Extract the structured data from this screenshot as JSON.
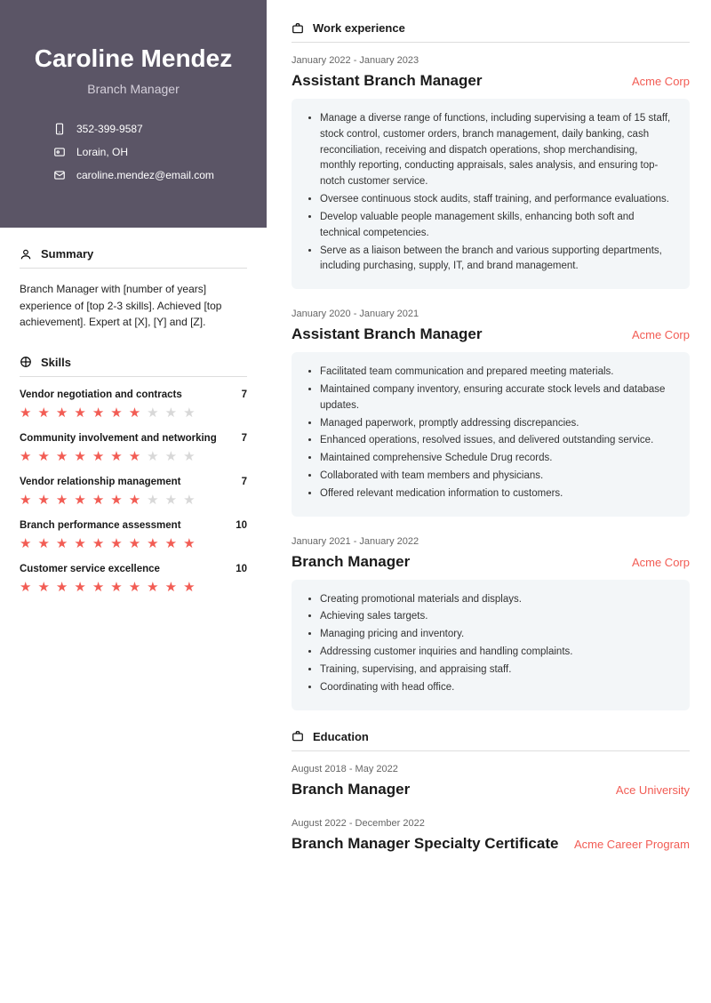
{
  "person": {
    "name": "Caroline Mendez",
    "title": "Branch Manager",
    "phone": "352-399-9587",
    "location": "Lorain, OH",
    "email": "caroline.mendez@email.com"
  },
  "sections": {
    "summary": "Summary",
    "skills": "Skills",
    "work": "Work experience",
    "education": "Education"
  },
  "summary_text": "Branch Manager with [number of years] experience of [top 2-3 skills]. Achieved [top achievement]. Expert at [X], [Y] and [Z].",
  "skills": [
    {
      "name": "Vendor negotiation and contracts",
      "rating": 7
    },
    {
      "name": "Community involvement and networking",
      "rating": 7
    },
    {
      "name": "Vendor relationship management",
      "rating": 7
    },
    {
      "name": "Branch performance assessment",
      "rating": 10
    },
    {
      "name": "Customer service excellence",
      "rating": 10
    }
  ],
  "jobs": [
    {
      "dates": "January 2022 - January 2023",
      "title": "Assistant Branch Manager",
      "company": "Acme Corp",
      "bullets": [
        "Manage a diverse range of functions, including supervising a team of 15 staff, stock control, customer orders, branch management, daily banking, cash reconciliation, receiving and dispatch operations, shop merchandising, monthly reporting, conducting appraisals, sales analysis, and ensuring top-notch customer service.",
        "Oversee continuous stock audits, staff training, and performance evaluations.",
        "Develop valuable people management skills, enhancing both soft and technical competencies.",
        "Serve as a liaison between the branch and various supporting departments, including purchasing, supply, IT, and brand management."
      ]
    },
    {
      "dates": "January 2020 - January 2021",
      "title": "Assistant Branch Manager",
      "company": "Acme Corp",
      "bullets": [
        "Facilitated team communication and prepared meeting materials.",
        "Maintained company inventory, ensuring accurate stock levels and database updates.",
        "Managed paperwork, promptly addressing discrepancies.",
        "Enhanced operations, resolved issues, and delivered outstanding service.",
        "Maintained comprehensive Schedule Drug records.",
        "Collaborated with team members and physicians.",
        "Offered relevant medication information to customers."
      ]
    },
    {
      "dates": "January 2021 - January 2022",
      "title": "Branch Manager",
      "company": "Acme Corp",
      "bullets": [
        "Creating promotional materials and displays.",
        "Achieving sales targets.",
        "Managing pricing and inventory.",
        "Addressing customer inquiries and handling complaints.",
        "Training, supervising, and appraising staff.",
        "Coordinating with head office."
      ]
    }
  ],
  "education": [
    {
      "dates": "August 2018 - May 2022",
      "title": "Branch Manager",
      "school": "Ace University"
    },
    {
      "dates": "August 2022 - December 2022",
      "title": "Branch Manager Specialty Certificate",
      "school": "Acme Career Program"
    }
  ]
}
